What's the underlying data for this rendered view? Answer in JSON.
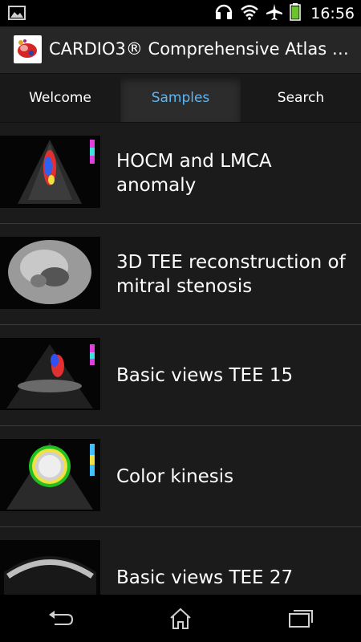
{
  "status_bar": {
    "time": "16:56",
    "icons": [
      "picture-icon",
      "headset-icon",
      "wifi-icon",
      "airplane-icon",
      "battery-icon"
    ],
    "battery_color": "#6dc22f"
  },
  "action_bar": {
    "title": "CARDIO3® Comprehensive Atlas of..."
  },
  "tabs": [
    {
      "label": "Welcome",
      "active": false
    },
    {
      "label": "Samples",
      "active": true
    },
    {
      "label": "Search",
      "active": false
    }
  ],
  "accent_color": "#5fb6f0",
  "samples": [
    {
      "title": "HOCM and LMCA anomaly"
    },
    {
      "title": "3D TEE reconstruction of mitral stenosis"
    },
    {
      "title": "Basic views TEE 15"
    },
    {
      "title": "Color kinesis"
    },
    {
      "title": "Basic views TEE 27"
    }
  ],
  "nav_bar": {
    "buttons": [
      "back-icon",
      "home-icon",
      "recent-apps-icon"
    ]
  }
}
